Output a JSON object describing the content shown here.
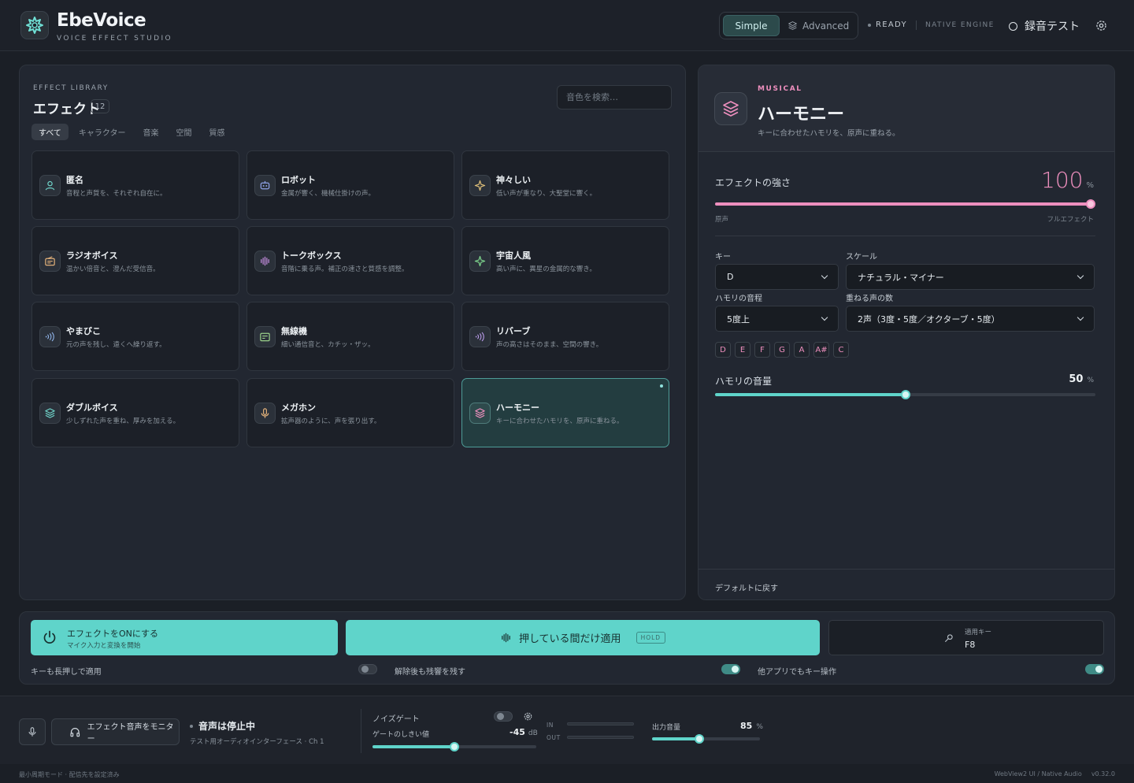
{
  "app": {
    "title": "EbeVoice",
    "subtitle": "VOICE EFFECT STUDIO"
  },
  "header": {
    "modes": {
      "simple": "Simple",
      "advanced": "Advanced",
      "selected": "Simple"
    },
    "status": "READY",
    "engine": "NATIVE ENGINE",
    "record_test": "録音テスト"
  },
  "library": {
    "eyebrow": "EFFECT LIBRARY",
    "title": "エフェクト",
    "count": "12",
    "search_placeholder": "音色を検索…",
    "tabs": [
      "すべて",
      "キャラクター",
      "音楽",
      "空間",
      "質感"
    ],
    "active_tab": "すべて",
    "effects": [
      {
        "name": "匿名",
        "desc": "音程と声質を、それぞれ自在に。",
        "icon": "user-icon"
      },
      {
        "name": "ロボット",
        "desc": "金属が響く、機械仕掛けの声。",
        "icon": "robot-icon"
      },
      {
        "name": "神々しい",
        "desc": "低い声が重なり、大聖堂に響く。",
        "icon": "sparkle-icon"
      },
      {
        "name": "ラジオボイス",
        "desc": "温かい倍音と、澄んだ受信音。",
        "icon": "radio-icon"
      },
      {
        "name": "トークボックス",
        "desc": "音階に乗る声。補正の速さと質感を調整。",
        "icon": "waveform-icon"
      },
      {
        "name": "宇宙人風",
        "desc": "高い声に、異星の金属的な響き。",
        "icon": "star-icon"
      },
      {
        "name": "やまびこ",
        "desc": "元の声を残し、遠くへ繰り返す。",
        "icon": "echo-icon"
      },
      {
        "name": "無線機",
        "desc": "細い通信音と、カチッ・ザッ。",
        "icon": "walkie-icon"
      },
      {
        "name": "リバーブ",
        "desc": "声の高さはそのまま、空間の響き。",
        "icon": "reverb-icon"
      },
      {
        "name": "ダブルボイス",
        "desc": "少しずれた声を重ね、厚みを加える。",
        "icon": "layers-icon"
      },
      {
        "name": "メガホン",
        "desc": "拡声器のように、声を張り出す。",
        "icon": "microphone-icon"
      },
      {
        "name": "ハーモニー",
        "desc": "キーに合わせたハモリを、原声に重ねる。",
        "icon": "layers-icon"
      }
    ],
    "active_effect": "ハーモニー"
  },
  "detail": {
    "category": "MUSICAL",
    "title": "ハーモニー",
    "description": "キーに合わせたハモリを、原声に重ねる。",
    "strength": {
      "label": "エフェクトの強さ",
      "value": "100",
      "unit": "%",
      "fraction": 1.0,
      "min_label": "原声",
      "max_label": "フルエフェクト"
    },
    "key": {
      "label": "キー",
      "value": "D"
    },
    "scale": {
      "label": "スケール",
      "value": "ナチュラル・マイナー"
    },
    "interval": {
      "label": "ハモリの音程",
      "value": "5度上"
    },
    "voices": {
      "label": "重ねる声の数",
      "value": "2声（3度・5度／オクターブ・5度）"
    },
    "scale_notes": [
      "D",
      "E",
      "F",
      "G",
      "A",
      "A#",
      "C"
    ],
    "harmony_volume": {
      "label": "ハモリの音量",
      "value": "50",
      "unit": "%",
      "fraction": 0.5
    },
    "reset_label": "デフォルトに戻す"
  },
  "actions": {
    "effect_on": {
      "title": "エフェクトをONにする",
      "subtitle": "マイク入力と変換を開始"
    },
    "hold": {
      "label": "押している間だけ適用",
      "badge": "HOLD"
    },
    "hotkey": {
      "label": "適用キー",
      "value": "F8"
    },
    "options": [
      {
        "label": "キーも長押しで適用",
        "on": false
      },
      {
        "label": "解除後も残響を残す",
        "on": true
      },
      {
        "label": "他アプリでもキー操作",
        "on": true
      }
    ]
  },
  "bottom": {
    "monitor_label": "エフェクト音声をモニター",
    "status": "音声は停止中",
    "device": "テスト用オーディオインターフェース · Ch 1",
    "noise_gate": {
      "label": "ノイズゲート",
      "on": false,
      "threshold_label": "ゲートのしきい値",
      "value": "-45",
      "unit": "dB",
      "fraction": 0.5
    },
    "meters": {
      "in": "IN",
      "out": "OUT"
    },
    "output": {
      "label": "出力音量",
      "value": "85",
      "unit": "%",
      "fraction": 0.44
    }
  },
  "footer": {
    "left": "最小周期モード · 配信先を設定済み",
    "engine": "WebView2 UI / Native Audio",
    "version": "v0.32.0"
  },
  "colors": {
    "accent": "#5fd4ca",
    "pink": "#ee8fbe",
    "background": "#1b1f26",
    "panel": "#222731"
  }
}
